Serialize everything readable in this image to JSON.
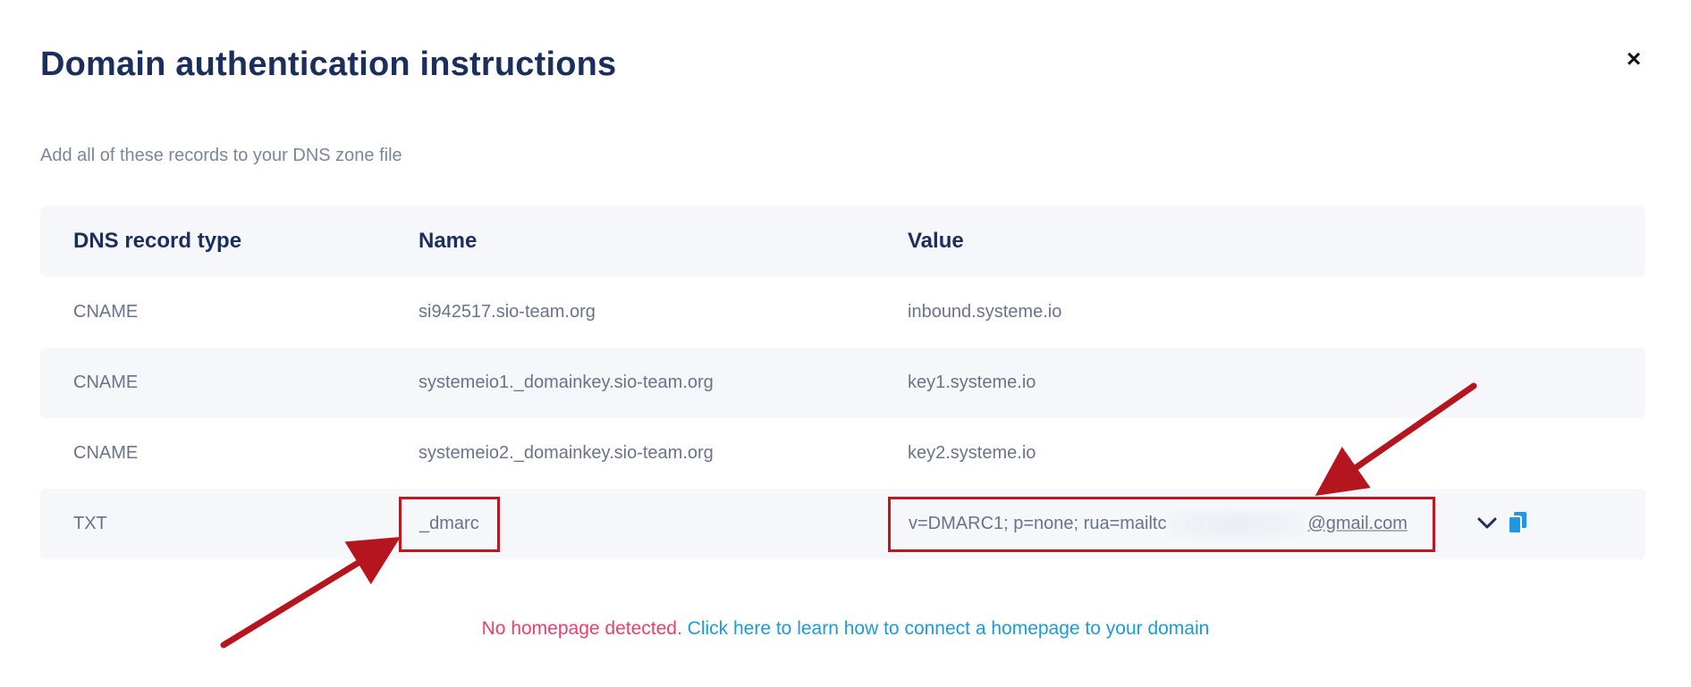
{
  "modal": {
    "title": "Domain authentication instructions",
    "close_label": "×",
    "subtitle": "Add all of these records to your DNS zone file"
  },
  "table": {
    "headers": [
      "DNS record type",
      "Name",
      "Value"
    ],
    "rows": [
      {
        "type": "CNAME",
        "name": "si942517.sio-team.org",
        "value": "inbound.systeme.io"
      },
      {
        "type": "CNAME",
        "name": "systemeio1._domainkey.sio-team.org",
        "value": "key1.systeme.io"
      },
      {
        "type": "CNAME",
        "name": "systemeio2._domainkey.sio-team.org",
        "value": "key2.systeme.io"
      },
      {
        "type": "TXT",
        "name": "_dmarc",
        "value_prefix": "v=DMARC1; p=none; rua=mailtc",
        "value_suffix": "@gmail.com"
      }
    ]
  },
  "footer": {
    "warning": "No homepage detected.",
    "link": "Click here to learn how to connect a homepage to your domain"
  },
  "icons": {
    "close": "close-icon",
    "expand": "chevron-down-icon",
    "copy": "copy-icon"
  },
  "colors": {
    "title": "#1c2e5c",
    "highlight": "#c0171f",
    "warning": "#e8416d",
    "link": "#1e9ad6",
    "copy_icon": "#2196e3"
  }
}
